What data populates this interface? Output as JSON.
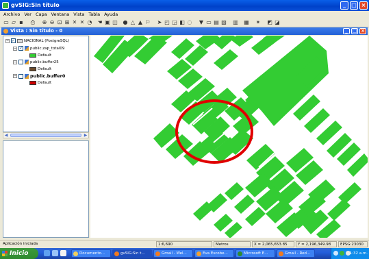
{
  "app": {
    "title": "gvSIG:Sin título"
  },
  "menu": [
    "Archivo",
    "Ver",
    "Capa",
    "Ventana",
    "Vista",
    "Tabla",
    "Ayuda"
  ],
  "view": {
    "title": "Vista : Sin título - 0"
  },
  "toc": {
    "group_label": "NACIONAL (PostgreSQL)",
    "layers": [
      {
        "name": "public.zap_total09",
        "legend": "Default",
        "checked": true,
        "color": "#33CC33",
        "bold": false
      },
      {
        "name": "public.buffer25",
        "legend": "Default",
        "checked": false,
        "color": "#6B4A2A",
        "bold": false
      },
      {
        "name": "public.buffer0",
        "legend": "Default",
        "checked": false,
        "color": "#CC0000",
        "bold": true
      }
    ]
  },
  "map": {
    "fill_color": "#33CC33",
    "highlight_color": "#E00000"
  },
  "status": {
    "message": "Aplicación iniciada",
    "scale": "1:6,690",
    "units": "Metros",
    "x": "X = 2,065,653.85",
    "y": "Y = 2,196,349.98",
    "epsg": "EPSG:23030"
  },
  "taskbar": {
    "start_label": "Inicio",
    "tasks": [
      "Documento...",
      "gvSIG:Sin t...",
      "Gmail - Wel...",
      "Eva Escobe...",
      "Microsoft E...",
      "Gmail - Red..."
    ],
    "clock": "11:32 a.m."
  }
}
